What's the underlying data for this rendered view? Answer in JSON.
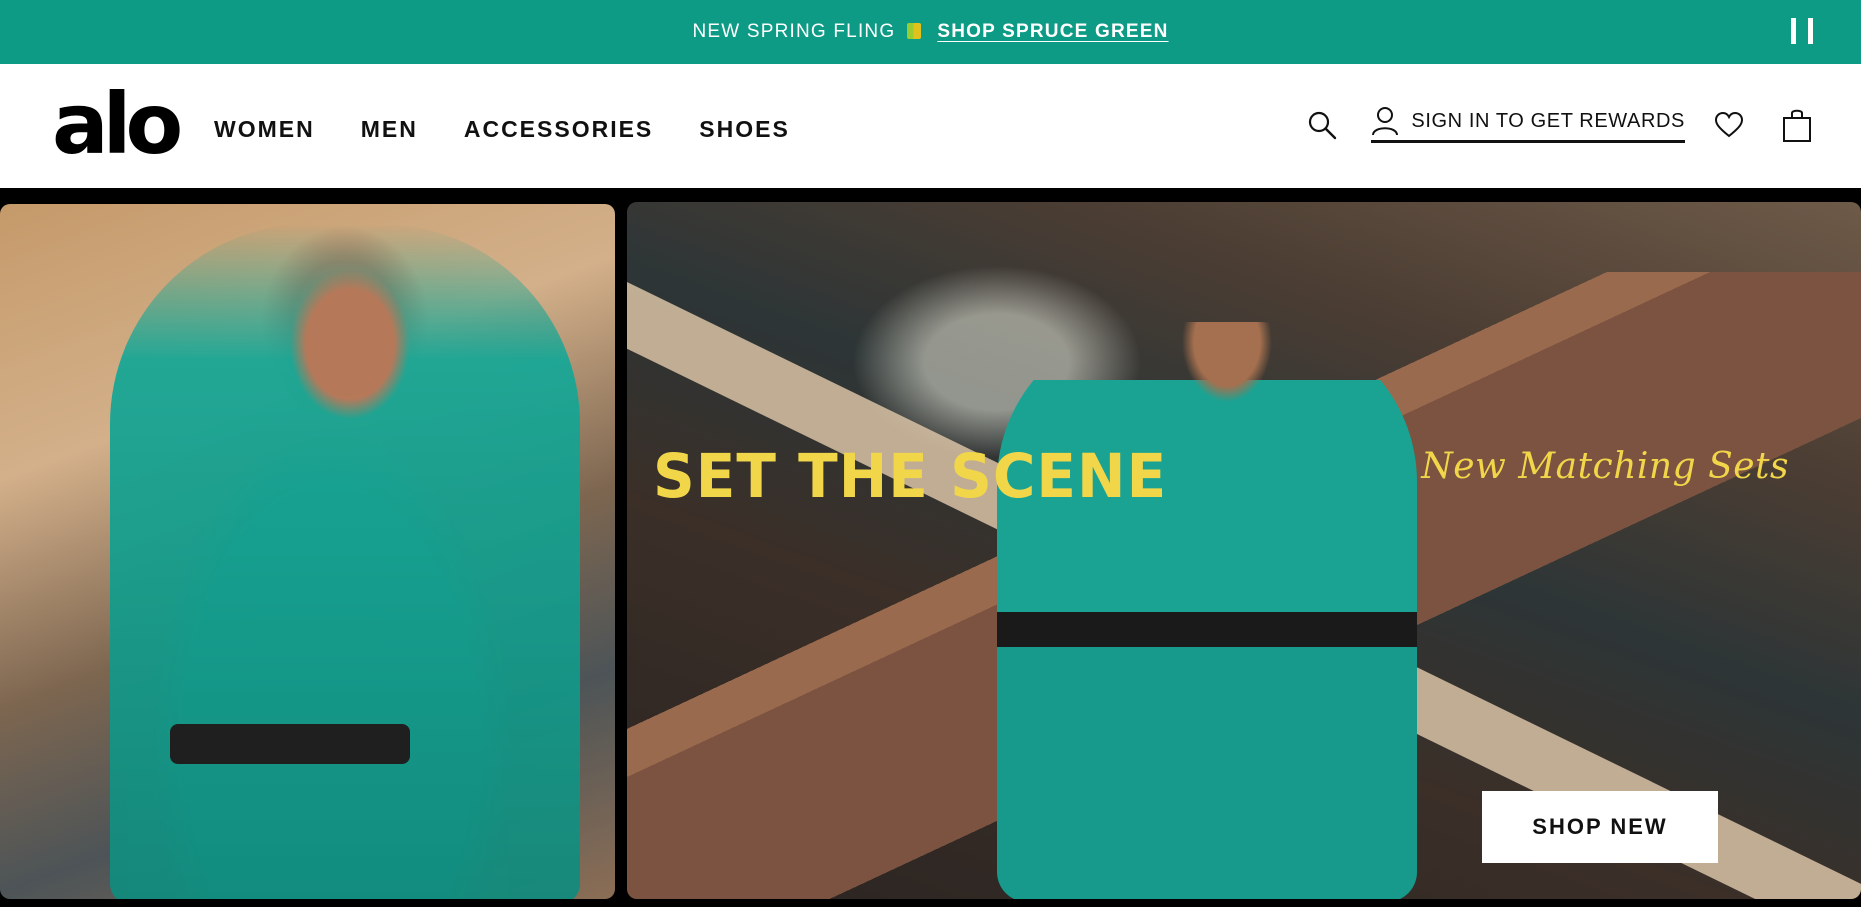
{
  "promo": {
    "text": "NEW SPRING FLING",
    "gift_icon": "gift-icon",
    "link_label": "SHOP SPRUCE GREEN",
    "pause_icon": "pause-icon",
    "background": "#0e9b85"
  },
  "header": {
    "logo": "alo",
    "nav": [
      {
        "label": "WOMEN"
      },
      {
        "label": "MEN"
      },
      {
        "label": "ACCESSORIES"
      },
      {
        "label": "SHOES"
      }
    ],
    "search_icon": "search-icon",
    "user_icon": "user-icon",
    "signin_label": "SIGN IN TO GET REWARDS",
    "wishlist_icon": "heart-icon",
    "bag_icon": "shopping-bag-icon"
  },
  "hero": {
    "title": "SET THE SCENE",
    "subtitle": "New Matching Sets",
    "cta_label": "SHOP NEW",
    "accent": "#f1d64a"
  }
}
